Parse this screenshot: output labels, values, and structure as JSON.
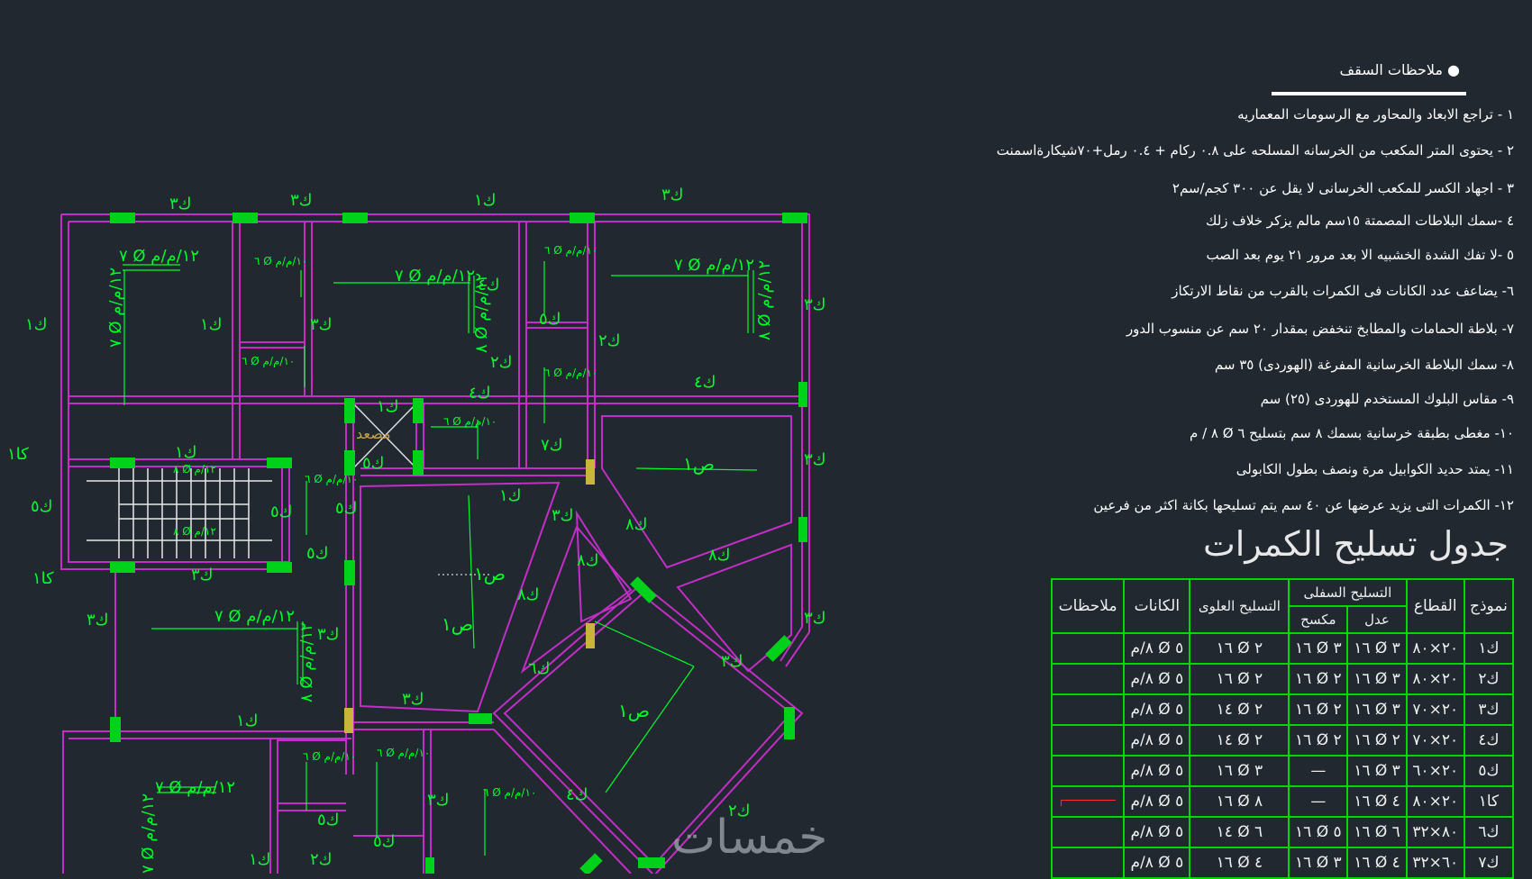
{
  "notes": {
    "title": "ملاحظات السقف",
    "items": [
      "١  - تراجع الابعاد والمحاور  مع الرسومات المعماريه",
      "٢  - يحتوى المتر المكعب من الخرسانه المسلحه على  ٠.٨  ركام + ٠.٤ رمل+٧٠شيكارةاسمنت",
      "٣  - اجهاد الكسر للمكعب الخرسانى لا يقل عن ٣٠٠ كجم/سم٢",
      "٤  -سمك البلاطات المصمتة  ١٥سم مالم يزكر خلاف زلك",
      "٥  -لا تفك الشدة الخشبيه الا بعد مرور ٢١ يوم بعد الصب",
      "٦- يضاعف عدد الكانات فى الكمرات بالقرب من نقاط الارتكاز",
      "٧- بلاطة الحمامات  والمطابخ تنخفض بمقدار ٢٠ سم عن منسوب الدور",
      "٨- سمك البلاطة الخرسانية المفرغة (الهوردى) ٣٥ سم",
      "٩- مقاس البلوك المستخدم للهوردى (٢٥)  سم",
      "١٠- مغطى بطبقة خرسانية بسمك ٨ سم بتسليح  ٦ Ø ٨ / م",
      "١١- يمتد حديد الكوابيل  مرة ونصف بطول الكابولى",
      "١٢- الكمرات التى يزيد عرضها عن ٤٠ سم يتم تسليحها بكانة اكثر من فرعين"
    ]
  },
  "beam_table": {
    "title": "جدول تسليح الكمرات",
    "headers": {
      "model": "نموذج",
      "section": "القطاع",
      "bottom_rft": "التسليح السفلى",
      "straight": "عدل",
      "bent": "مكسح",
      "top_rft": "التسليح العلوى",
      "stirrups": "الكانات",
      "remarks": "ملاحظات"
    },
    "rows": [
      {
        "model": "ك١",
        "section": "٢٠×٨٠",
        "straight": "٣ Ø ١٦",
        "bent": "٣ Ø ١٦",
        "top": "٢ Ø ١٦",
        "stirrups": "٥ Ø ٨/م",
        "remarks": ""
      },
      {
        "model": "ك٢",
        "section": "٢٠×٨٠",
        "straight": "٣ Ø ١٦",
        "bent": "٢ Ø ١٦",
        "top": "٢ Ø ١٦",
        "stirrups": "٥ Ø ٨/م",
        "remarks": ""
      },
      {
        "model": "ك٣",
        "section": "٢٠×٧٠",
        "straight": "٣ Ø ١٦",
        "bent": "٢ Ø ١٦",
        "top": "٢ Ø ١٤",
        "stirrups": "٥ Ø ٨/م",
        "remarks": ""
      },
      {
        "model": "ك٤",
        "section": "٢٠×٧٠",
        "straight": "٢ Ø ١٦",
        "bent": "٢ Ø ١٦",
        "top": "٢ Ø ١٤",
        "stirrups": "٥ Ø ٨/م",
        "remarks": ""
      },
      {
        "model": "ك٥",
        "section": "٢٠×٦٠",
        "straight": "٣ Ø ١٦",
        "bent": "—",
        "top": "٣ Ø ١٦",
        "stirrups": "٥ Ø ٨/م",
        "remarks": ""
      },
      {
        "model": "كا١",
        "section": "٢٠×٨٠",
        "straight": "٤ Ø ١٦",
        "bent": "—",
        "top": "٨ Ø ١٦",
        "stirrups": "٥ Ø ٨/م",
        "remarks": ""
      },
      {
        "model": "ك٦",
        "section": "٨٠×٣٢",
        "straight": "٦ Ø ١٦",
        "bent": "٥ Ø ١٦",
        "top": "٦ Ø ١٤",
        "stirrups": "٥ Ø ٨/م",
        "remarks": ""
      },
      {
        "model": "ك٧",
        "section": "٦٠×٣٢",
        "straight": "٤ Ø ١٦",
        "bent": "٣ Ø ١٦",
        "top": "٤ Ø ١٦",
        "stirrups": "٥ Ø ٨/م",
        "remarks": ""
      }
    ]
  },
  "plan": {
    "beam_labels": [
      {
        "id": "a1",
        "t": "ك٣"
      },
      {
        "id": "a2",
        "t": "ك٣"
      },
      {
        "id": "a3",
        "t": "ك١"
      },
      {
        "id": "a4",
        "t": "ك٣"
      },
      {
        "id": "a5",
        "t": "ك١"
      },
      {
        "id": "a6",
        "t": "ك١"
      },
      {
        "id": "a7",
        "t": "ك٢"
      },
      {
        "id": "a8",
        "t": "ك٥"
      },
      {
        "id": "a9",
        "t": "ك١"
      },
      {
        "id": "a10",
        "t": "ك٣"
      },
      {
        "id": "a11",
        "t": "ك٢"
      },
      {
        "id": "a12",
        "t": "ك٤"
      },
      {
        "id": "a13",
        "t": "ك٣"
      },
      {
        "id": "a14",
        "t": "ك٤"
      },
      {
        "id": "a15",
        "t": "كا١"
      },
      {
        "id": "a16",
        "t": "ك١"
      },
      {
        "id": "a17",
        "t": "ك٥"
      },
      {
        "id": "a18",
        "t": "ك٥"
      },
      {
        "id": "a19",
        "t": "ك٥"
      },
      {
        "id": "a20",
        "t": "ك٥"
      },
      {
        "id": "a21",
        "t": "ك٥"
      },
      {
        "id": "a22",
        "t": "ك٣"
      },
      {
        "id": "a23",
        "t": "كا١"
      },
      {
        "id": "a24",
        "t": "ك٣"
      },
      {
        "id": "a25",
        "t": "ك١"
      },
      {
        "id": "a26",
        "t": "ك٨"
      },
      {
        "id": "a27",
        "t": "ك٨"
      },
      {
        "id": "a28",
        "t": "ك٨"
      },
      {
        "id": "a29",
        "t": "ك٨"
      },
      {
        "id": "a30",
        "t": "ك٣"
      },
      {
        "id": "a31",
        "t": "ك٣"
      },
      {
        "id": "a32",
        "t": "ك٣"
      },
      {
        "id": "a33",
        "t": "ك٦"
      },
      {
        "id": "a34",
        "t": "ك٣"
      },
      {
        "id": "a35",
        "t": "ك٣"
      },
      {
        "id": "a36",
        "t": "ك١"
      },
      {
        "id": "a37",
        "t": "ك٤"
      },
      {
        "id": "a38",
        "t": "ك٢"
      },
      {
        "id": "a39",
        "t": "ك٥"
      },
      {
        "id": "a40",
        "t": "ك٥"
      },
      {
        "id": "a41",
        "t": "ك٣"
      },
      {
        "id": "a42",
        "t": "ك١"
      },
      {
        "id": "a43",
        "t": "ك٢"
      },
      {
        "id": "a44",
        "t": "ك٣"
      },
      {
        "id": "a45",
        "t": "ك٤"
      },
      {
        "id": "a46",
        "t": "ك٧"
      }
    ],
    "slab_rft": {
      "main": "٧ Ø ١٢/م/م",
      "small": "٦ Ø ١٠/م/م",
      "side": "٧ Ø ١٢/م/م",
      "side8": "٨ Ø ١٢/م/م",
      "stair": "٨ Ø ١٢/م"
    },
    "hollow_labels": {
      "h1": "ص١",
      "h2": "ص١",
      "h3": "ص١",
      "h4": "ص١"
    },
    "elevator": "مصعد"
  },
  "watermark": "خمسات",
  "colors": {
    "background": "#212830",
    "beam": "#c22ec6",
    "text": "#00ff2a",
    "column": "#00d21c",
    "white": "#ffffff"
  }
}
